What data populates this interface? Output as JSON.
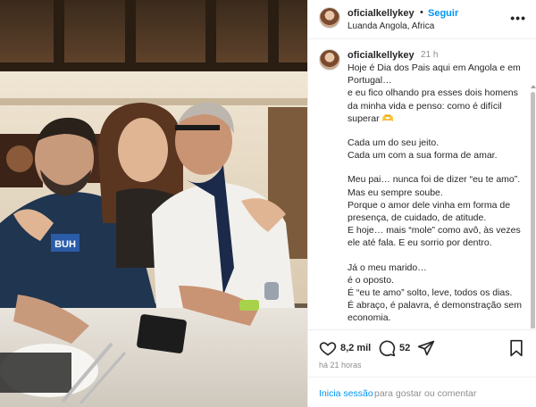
{
  "post": {
    "username": "oficialkellykey",
    "follow_label": "Seguir",
    "separator": "•",
    "location": "Luanda Angola, Africa",
    "more_label": "•••",
    "jersey_text": "BUH"
  },
  "caption": {
    "username": "oficialkellykey",
    "time": "21 h",
    "lines": [
      "Hoje é Dia dos Pais aqui em Angola e em Portugal…",
      "e eu fico olhando pra esses dois homens da minha vida e penso: como é difícil superar 🫶",
      "",
      "Cada um do seu jeito.",
      "Cada um com a sua forma de amar.",
      "",
      "Meu pai… nunca foi de dizer “eu te amo”.",
      "Mas eu sempre soube.",
      "Porque o amor dele vinha em forma de presença, de cuidado, de atitude.",
      "E hoje… mais “mole” como avô, às vezes ele até fala. E eu sorrio por dentro.",
      "",
      "Já o meu marido…",
      "é o oposto.",
      "É “eu te amo” solto, leve, todos os dias.",
      "É abraço, é palavra, é demonstração sem economia."
    ]
  },
  "actions": {
    "like_icon": "heart-icon",
    "likes": "8,2 mil",
    "comment_icon": "comment-icon",
    "comments": "52",
    "share_icon": "share-icon",
    "save_icon": "bookmark-icon"
  },
  "meta": {
    "time_ago": "há 21 horas"
  },
  "footer": {
    "login_label": "Inicia sessão",
    "login_rest": "para gostar ou comentar"
  },
  "colors": {
    "accent": "#0095f6",
    "text": "#262626",
    "muted": "#8e8e8e"
  }
}
